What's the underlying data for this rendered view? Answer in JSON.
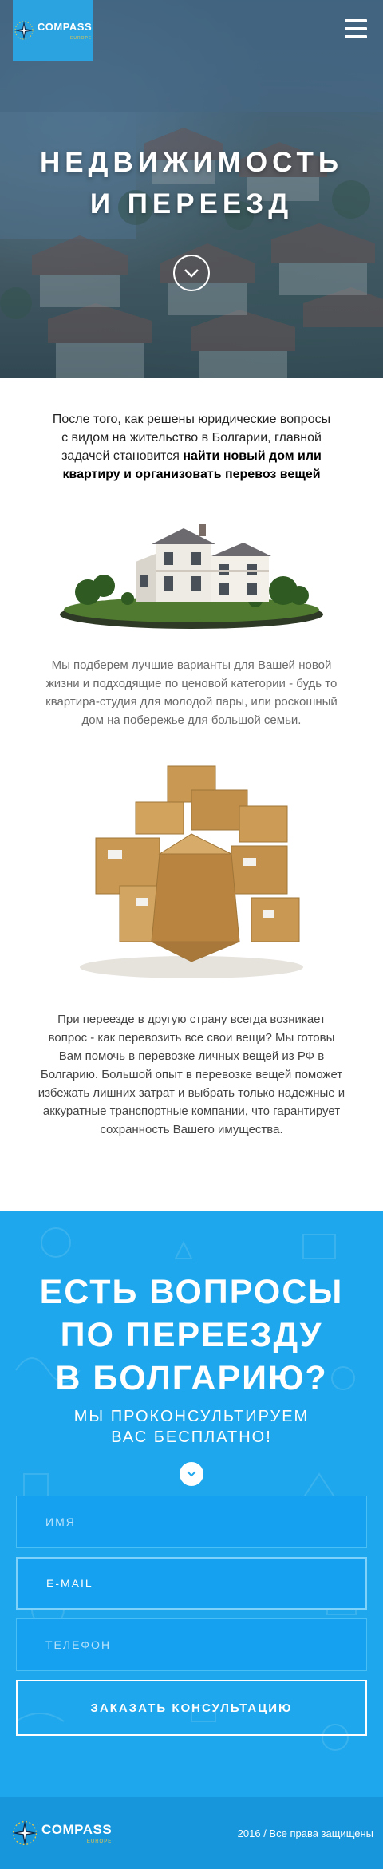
{
  "header": {
    "logo_text": "COMPASS",
    "logo_subtext": "EUROPE",
    "menu_icon": "hamburger-menu-icon"
  },
  "hero": {
    "title_line1": "НЕДВИЖИМОСТЬ",
    "title_line2": "И ПЕРЕЕЗД",
    "scroll_icon": "chevron-down-icon"
  },
  "content": {
    "intro_text": "После того, как решены юридические вопросы с видом на жительство в Болгарии, главной задачей становится ",
    "intro_bold": "найти новый дом или квартиру и организовать перевоз вещей",
    "paragraph_housing": "Мы подберем лучшие варианты для Вашей новой жизни и подходящие по ценовой категории - будь то квартира-студия для молодой пары, или роскошный дом на побережье для большой семьи.",
    "paragraph_moving": "При переезде в другую страну всегда возникает вопрос - как перевозить все свои вещи? Мы готовы Вам помочь в перевозке личных вещей из РФ в Болгарию. Большой опыт в перевозке вещей поможет избежать лишних затрат и выбрать только надежные и аккуратные транспортные компании, что гарантирует сохранность Вашего имущества."
  },
  "cta": {
    "title_line1": "ЕСТЬ ВОПРОСЫ",
    "title_line2": "ПО ПЕРЕЕЗДУ",
    "title_line3": "В БОЛГАРИЮ?",
    "subtitle_line1": "МЫ ПРОКОНСУЛЬТИРУЕМ",
    "subtitle_line2": "ВАС БЕСПЛАТНО!",
    "form": {
      "name_placeholder": "ИМЯ",
      "email_placeholder": "E-MAIL",
      "phone_placeholder": "ТЕЛЕФОН",
      "submit_label": "ЗАКАЗАТЬ КОНСУЛЬТАЦИЮ"
    }
  },
  "footer": {
    "logo_text": "COMPASS",
    "logo_subtext": "EUROPE",
    "copyright": "2016 / Все права защищены"
  },
  "colors": {
    "brand_blue": "#2aa3e0",
    "cta_background": "#1ea7ec",
    "footer_background": "#1796dc"
  }
}
